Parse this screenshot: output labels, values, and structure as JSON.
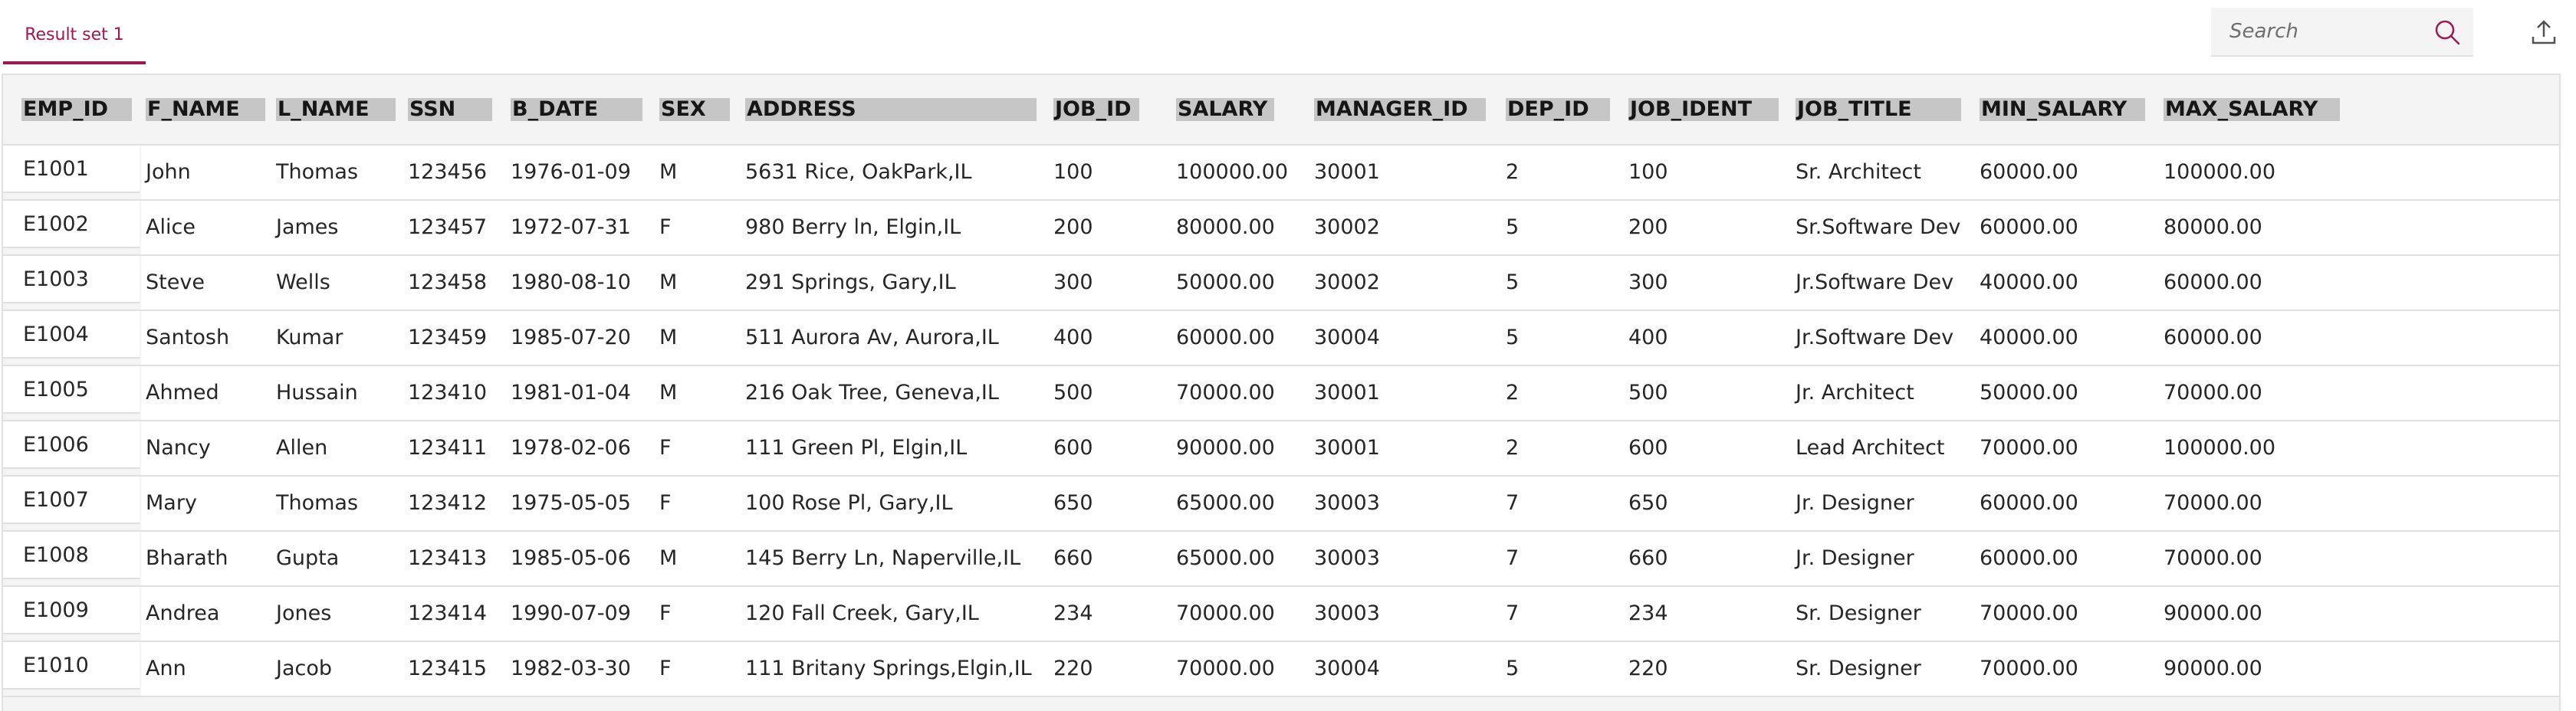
{
  "tab": {
    "label": "Result set 1"
  },
  "search": {
    "placeholder": "Search"
  },
  "icons": {
    "search": "search-icon",
    "export": "upload-export-icon"
  },
  "colors": {
    "accent": "#9f1853",
    "header_bg": "#c6c6c6",
    "table_bg": "#f4f4f4"
  },
  "table": {
    "columns": [
      "EMP_ID",
      "F_NAME",
      "L_NAME",
      "SSN",
      "B_DATE",
      "SEX",
      "ADDRESS",
      "JOB_ID",
      "SALARY",
      "MANAGER_ID",
      "DEP_ID",
      "JOB_IDENT",
      "JOB_TITLE",
      "MIN_SALARY",
      "MAX_SALARY"
    ],
    "rows": [
      [
        "E1001",
        "John",
        "Thomas",
        "123456",
        "1976-01-09",
        "M",
        "5631 Rice, OakPark,IL",
        "100",
        "100000.00",
        "30001",
        "2",
        "100",
        "Sr. Architect",
        "60000.00",
        "100000.00"
      ],
      [
        "E1002",
        "Alice",
        "James",
        "123457",
        "1972-07-31",
        "F",
        "980 Berry ln, Elgin,IL",
        "200",
        "80000.00",
        "30002",
        "5",
        "200",
        "Sr.Software Dev",
        "60000.00",
        "80000.00"
      ],
      [
        "E1003",
        "Steve",
        "Wells",
        "123458",
        "1980-08-10",
        "M",
        "291 Springs, Gary,IL",
        "300",
        "50000.00",
        "30002",
        "5",
        "300",
        "Jr.Software Dev",
        "40000.00",
        "60000.00"
      ],
      [
        "E1004",
        "Santosh",
        "Kumar",
        "123459",
        "1985-07-20",
        "M",
        "511 Aurora Av, Aurora,IL",
        "400",
        "60000.00",
        "30004",
        "5",
        "400",
        "Jr.Software Dev",
        "40000.00",
        "60000.00"
      ],
      [
        "E1005",
        "Ahmed",
        "Hussain",
        "123410",
        "1981-01-04",
        "M",
        "216 Oak Tree, Geneva,IL",
        "500",
        "70000.00",
        "30001",
        "2",
        "500",
        "Jr. Architect",
        "50000.00",
        "70000.00"
      ],
      [
        "E1006",
        "Nancy",
        "Allen",
        "123411",
        "1978-02-06",
        "F",
        "111 Green Pl, Elgin,IL",
        "600",
        "90000.00",
        "30001",
        "2",
        "600",
        "Lead Architect",
        "70000.00",
        "100000.00"
      ],
      [
        "E1007",
        "Mary",
        "Thomas",
        "123412",
        "1975-05-05",
        "F",
        "100 Rose Pl, Gary,IL",
        "650",
        "65000.00",
        "30003",
        "7",
        "650",
        "Jr. Designer",
        "60000.00",
        "70000.00"
      ],
      [
        "E1008",
        "Bharath",
        "Gupta",
        "123413",
        "1985-05-06",
        "M",
        "145 Berry Ln, Naperville,IL",
        "660",
        "65000.00",
        "30003",
        "7",
        "660",
        "Jr. Designer",
        "60000.00",
        "70000.00"
      ],
      [
        "E1009",
        "Andrea",
        "Jones",
        "123414",
        "1990-07-09",
        "F",
        "120 Fall Creek, Gary,IL",
        "234",
        "70000.00",
        "30003",
        "7",
        "234",
        "Sr. Designer",
        "70000.00",
        "90000.00"
      ],
      [
        "E1010",
        "Ann",
        "Jacob",
        "123415",
        "1982-03-30",
        "F",
        "111 Britany Springs,Elgin,IL",
        "220",
        "70000.00",
        "30004",
        "5",
        "220",
        "Sr. Designer",
        "70000.00",
        "90000.00"
      ]
    ]
  }
}
